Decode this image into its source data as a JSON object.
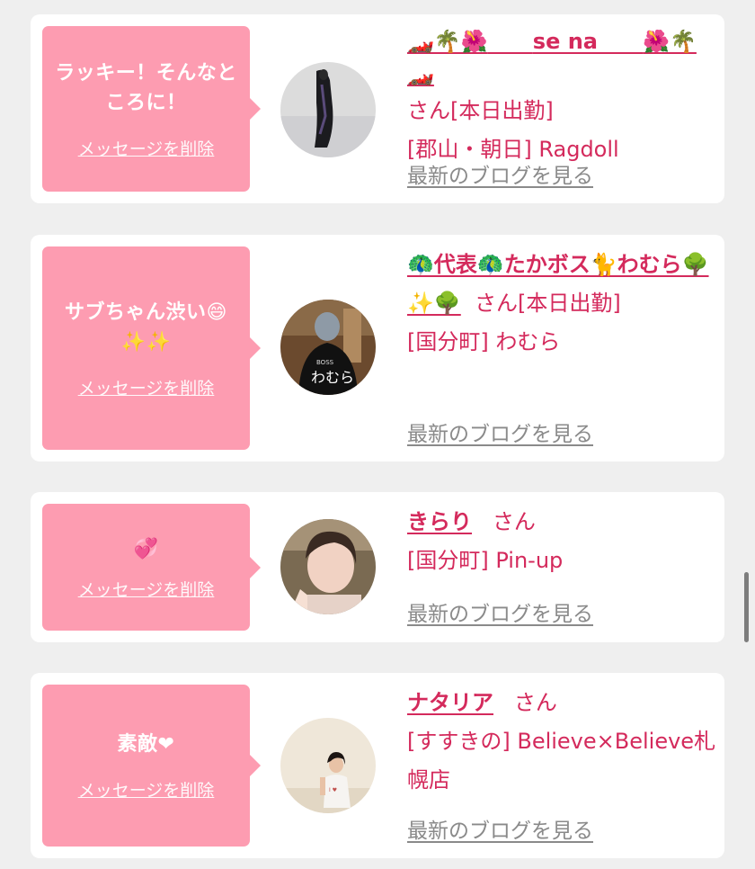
{
  "entries": [
    {
      "message": "ラッキー！そんなところに！",
      "delete_label": "メッセージを削除",
      "name_prefix": "🏎️🌴🌺",
      "name": "se na",
      "name_suffix": "🌺🌴🏎️",
      "honorific": "さん",
      "status": "[本日出勤]",
      "location": "[郡山・朝日] Ragdoll",
      "blog_label": "最新のブログを見る"
    },
    {
      "message": "サブちゃん渋い😄✨✨",
      "delete_label": "メッセージを削除",
      "name": "🦚代表🦚たかボス🐈わむら🌳✨🌳",
      "honorific": "さん",
      "status": "[本日出勤]",
      "location": "[国分町] わむら",
      "blog_label": "最新のブログを見る"
    },
    {
      "message": "💞",
      "delete_label": "メッセージを削除",
      "name": "きらり",
      "honorific": "さん",
      "status": "",
      "location": "[国分町] Pin-up",
      "blog_label": "最新のブログを見る"
    },
    {
      "message": "素敵❤",
      "delete_label": "メッセージを削除",
      "name": "ナタリア",
      "honorific": "さん",
      "status": "",
      "location": "[すすきの] Believe×Believe札幌店",
      "blog_label": "最新のブログを見る"
    }
  ],
  "colors": {
    "bubble": "#fd9cb1",
    "accent": "#d42a5c",
    "muted": "#8a8a8a",
    "background": "#efefef"
  }
}
